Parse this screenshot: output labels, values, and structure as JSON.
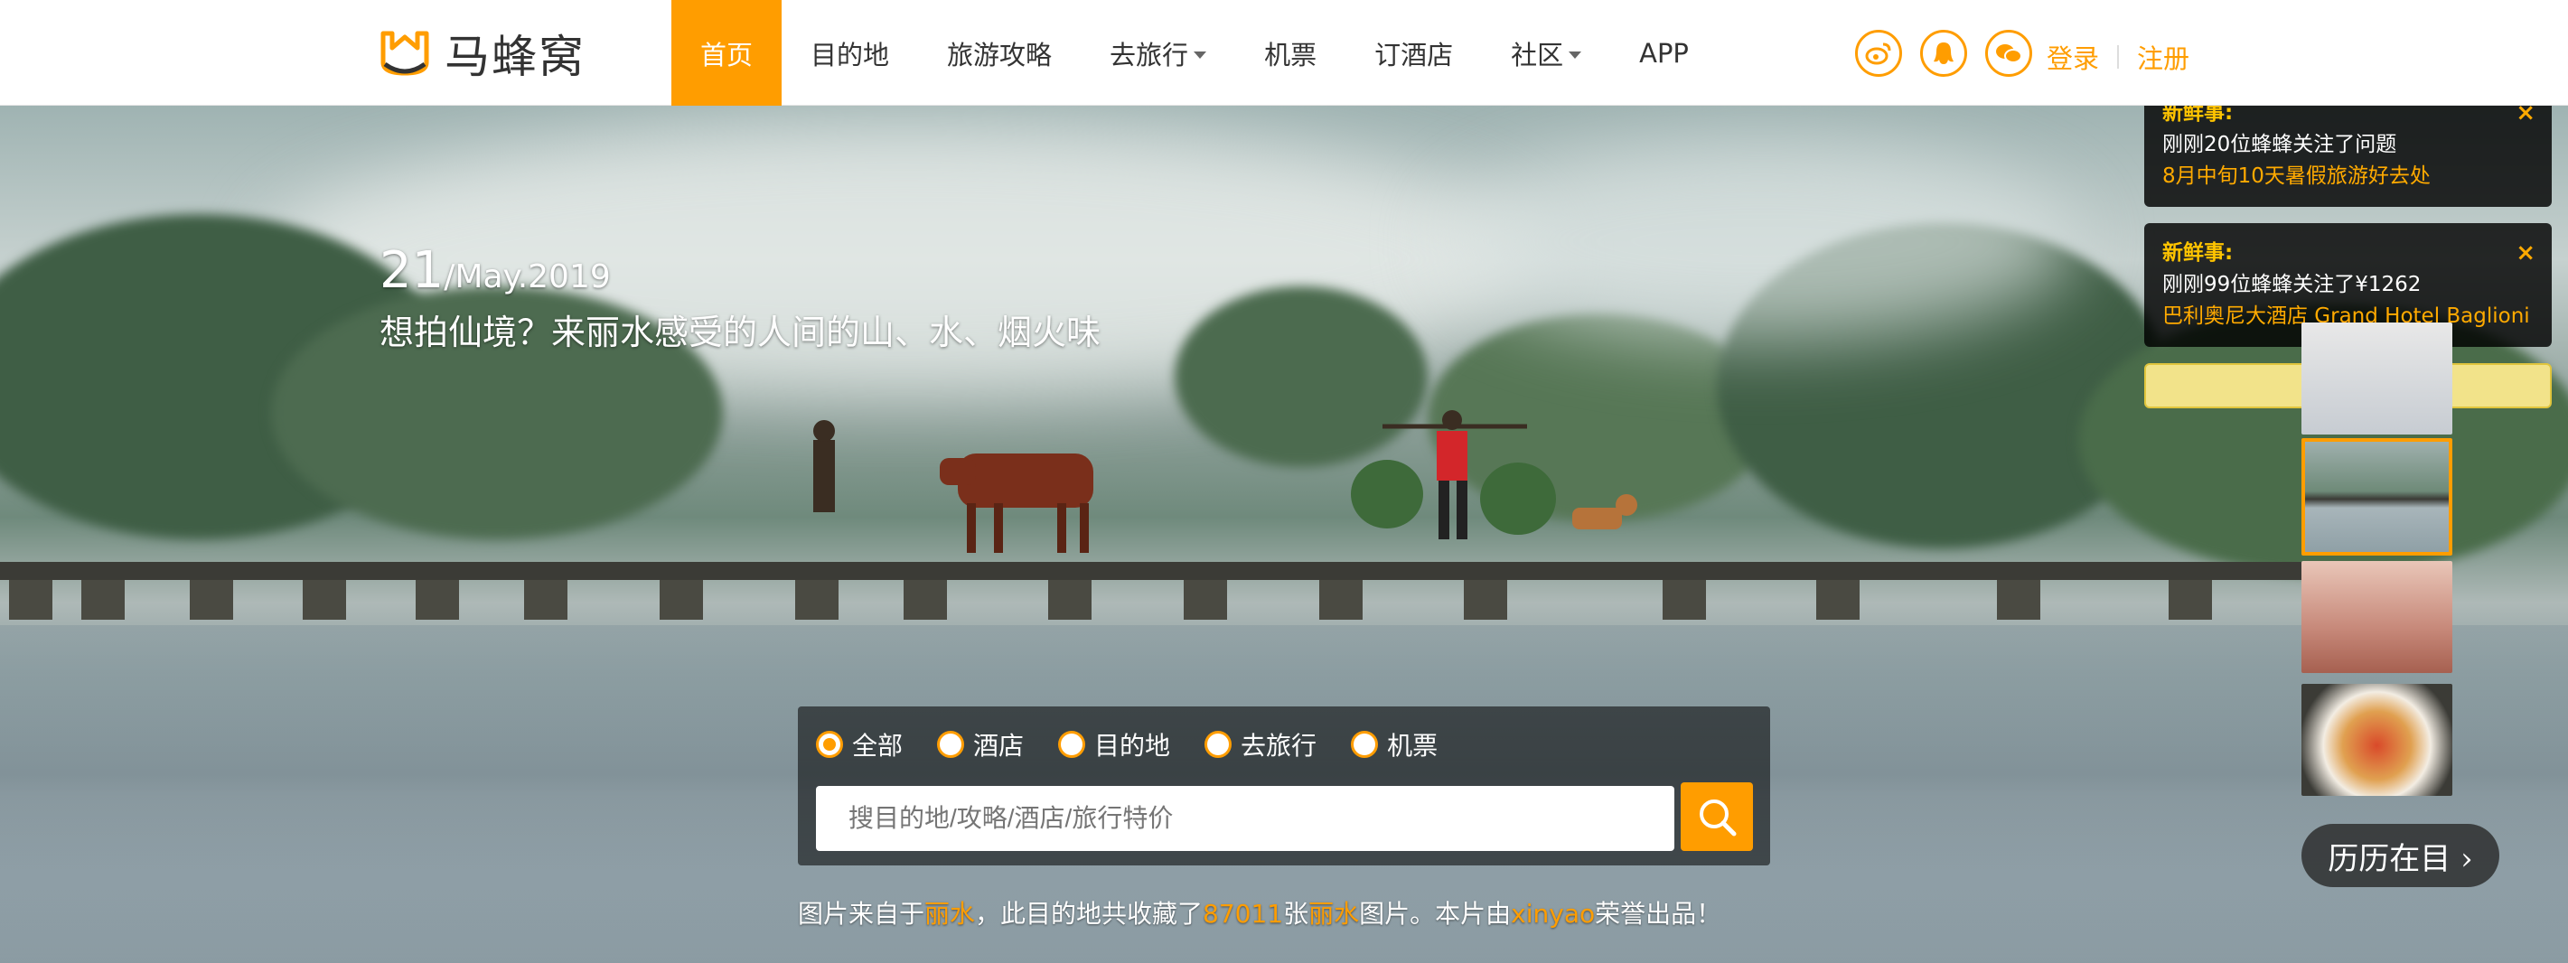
{
  "header": {
    "logo_text": "马蜂窝",
    "nav": [
      {
        "label": "首页",
        "active": true,
        "dropdown": false
      },
      {
        "label": "目的地",
        "active": false,
        "dropdown": false
      },
      {
        "label": "旅游攻略",
        "active": false,
        "dropdown": false
      },
      {
        "label": "去旅行",
        "active": false,
        "dropdown": true
      },
      {
        "label": "机票",
        "active": false,
        "dropdown": false
      },
      {
        "label": "订酒店",
        "active": false,
        "dropdown": false
      },
      {
        "label": "社区",
        "active": false,
        "dropdown": true
      },
      {
        "label": "APP",
        "active": false,
        "dropdown": false
      }
    ],
    "social_icons": [
      "weibo-icon",
      "qq-icon",
      "wechat-icon"
    ],
    "login": "登录",
    "register": "注册"
  },
  "hero": {
    "day": "21",
    "month_year": "/May.2019",
    "headline": "想拍仙境？来丽水感受的人间的山、水、烟火味"
  },
  "search": {
    "options": [
      {
        "label": "全部",
        "checked": true
      },
      {
        "label": "酒店",
        "checked": false
      },
      {
        "label": "目的地",
        "checked": false
      },
      {
        "label": "去旅行",
        "checked": false
      },
      {
        "label": "机票",
        "checked": false
      }
    ],
    "placeholder": "搜目的地/攻略/酒店/旅行特价"
  },
  "credit": {
    "p1": "图片来自于",
    "place1": "丽水",
    "p2": "，此目的地共收藏了",
    "count": "87011",
    "p3": "张",
    "place2": "丽水",
    "p4": "图片。本片由",
    "author": "xinyao",
    "p5": "荣誉出品！"
  },
  "notices": [
    {
      "title": "新鲜事:",
      "body": "刚刚20位蜂蜂关注了问题",
      "link": "8月中旬10天暑假旅游好去处"
    },
    {
      "title": "新鲜事:",
      "body": "刚刚99位蜂蜂关注了¥1262",
      "link": "巴利奥尼大酒店 Grand Hotel Baglioni"
    }
  ],
  "notice_close": "[ 关闭 ]",
  "more_button": "历历在目 ›",
  "colors": {
    "brand": "#ff9d00",
    "notice_title": "#ffc400"
  }
}
